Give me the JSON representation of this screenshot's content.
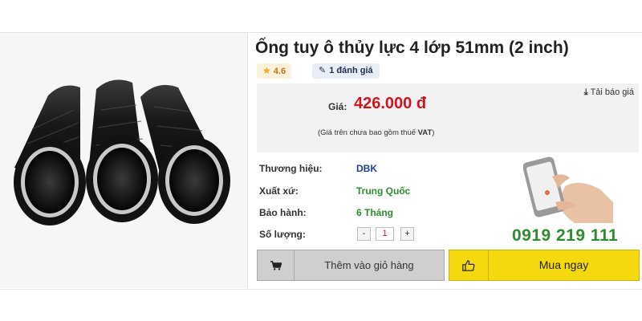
{
  "product": {
    "title": "Ống tuy ô thủy lực 4 lớp 51mm (2 inch)",
    "rating": "4.6",
    "reviews": "1 đánh giá"
  },
  "price_box": {
    "download_label": "Tải báo giá",
    "price_label": "Giá:",
    "price_value": "426.000 đ",
    "note_prefix": "(Giá trên chưa bao gồm thuế ",
    "note_bold": "VAT",
    "note_suffix": ")"
  },
  "specs": [
    {
      "label": "Thương hiệu:",
      "value": "DBK"
    },
    {
      "label": "Xuất xứ:",
      "value": "Trung Quốc"
    },
    {
      "label": "Bảo hành:",
      "value": "6 Tháng"
    },
    {
      "label": "Số lượng:",
      "value": ""
    }
  ],
  "quantity": {
    "minus": "-",
    "value": "1",
    "plus": "+"
  },
  "hotline": "0919 219 111",
  "buttons": {
    "add_to_cart": "Thêm vào giỏ hàng",
    "buy_now": "Mua ngay"
  },
  "icons": {
    "star": "star-icon",
    "pen": "pen-icon",
    "download": "download-icon",
    "cart": "cart-icon",
    "thumb": "thumbs-up-icon",
    "phone": "phone-hand-illustration"
  },
  "colors": {
    "price": "#d0151b",
    "hotline": "#2f8b2f",
    "brand": "#1f3f9e",
    "buy_button": "#f4d90f",
    "cart_button": "#cfcfcf"
  }
}
